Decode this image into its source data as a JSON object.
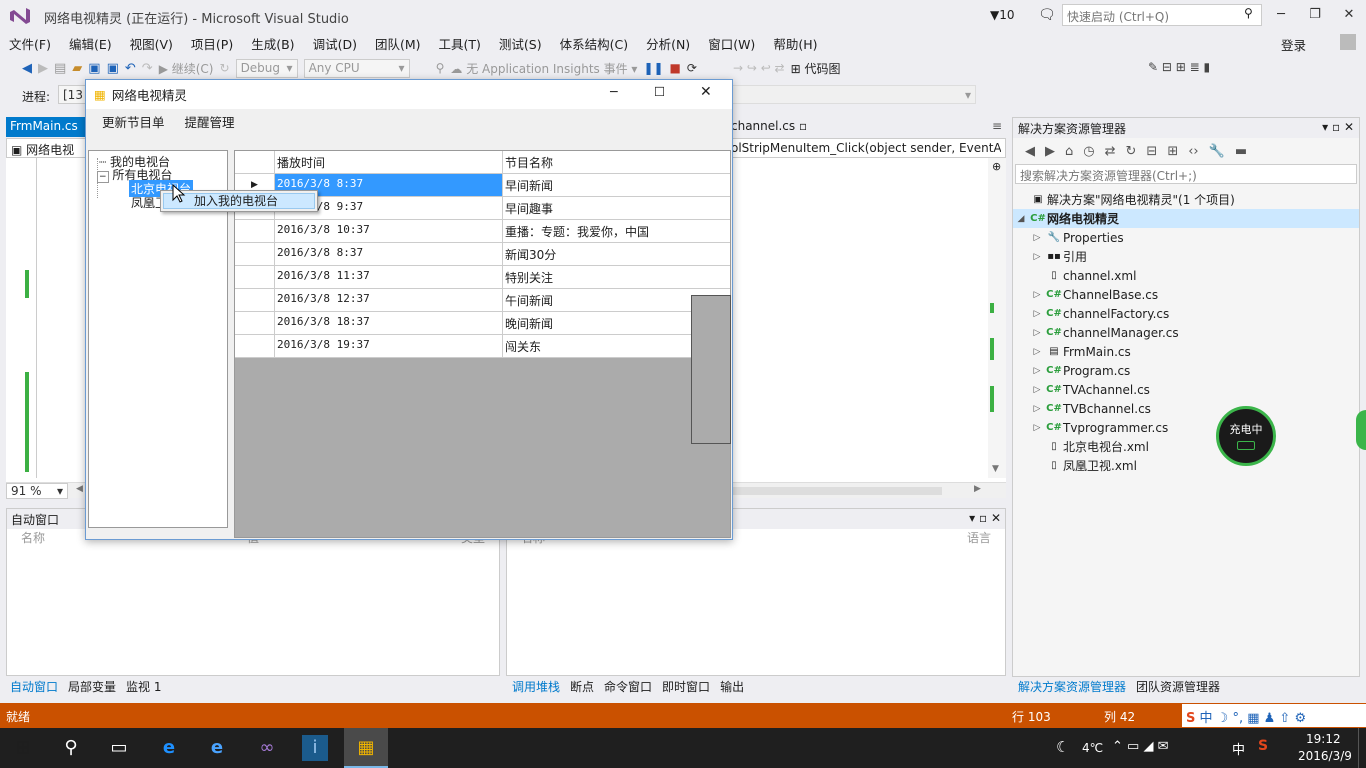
{
  "vs": {
    "title": "网络电视精灵 (正在运行) - Microsoft Visual Studio",
    "notif_count": "10",
    "quick_launch_placeholder": "快速启动 (Ctrl+Q)",
    "login": "登录",
    "menu": [
      "文件(F)",
      "编辑(E)",
      "视图(V)",
      "项目(P)",
      "生成(B)",
      "调试(D)",
      "团队(M)",
      "工具(T)",
      "测试(S)",
      "体系结构(C)",
      "分析(N)",
      "窗口(W)",
      "帮助(H)"
    ],
    "toolbar": {
      "continue": "继续(C)",
      "config": "Debug",
      "platform": "Any CPU",
      "insights": "无 Application Insights 事件",
      "codemap": "代码图"
    },
    "process_label": "进程:",
    "process_value": "[13",
    "doc_tab": "FrmMain.cs",
    "doc_tab2": "channel.cs",
    "nav_left": "网络电视",
    "nav_method": "olStripMenuItem_Click(object sender, EventA",
    "zoom": "91 %"
  },
  "autos": {
    "title": "自动窗口",
    "cols": [
      "名称",
      "值",
      "类型"
    ]
  },
  "callstack": {
    "cols": [
      "名称",
      "语言"
    ]
  },
  "bottom_tabs_left": [
    "自动窗口",
    "局部变量",
    "监视 1"
  ],
  "bottom_tabs_right": [
    "调用堆栈",
    "断点",
    "命令窗口",
    "即时窗口",
    "输出"
  ],
  "solution_explorer": {
    "title": "解决方案资源管理器",
    "search_placeholder": "搜索解决方案资源管理器(Ctrl+;)",
    "solution": "解决方案\"网络电视精灵\"(1 个项目)",
    "project": "网络电视精灵",
    "items": [
      "Properties",
      "引用",
      "channel.xml",
      "ChannelBase.cs",
      "channelFactory.cs",
      "channelManager.cs",
      "FrmMain.cs",
      "Program.cs",
      "TVAchannel.cs",
      "TVBchannel.cs",
      "Tvprogrammer.cs",
      "北京电视台.xml",
      "凤凰卫视.xml"
    ],
    "tabs": [
      "解决方案资源管理器",
      "团队资源管理器"
    ]
  },
  "charging": "充电中",
  "status": {
    "ready": "就绪",
    "line": "行 103",
    "col": "列 42"
  },
  "taskbar": {
    "weather": "4℃",
    "ime": "中",
    "time": "19:12",
    "date": "2016/3/9"
  },
  "app": {
    "title": "网络电视精灵",
    "menu": [
      "更新节目单",
      "提醒管理"
    ],
    "tree": {
      "my": "我的电视台",
      "all": "所有电视台",
      "child1": "北京电视台",
      "child2": "凤凰卫视"
    },
    "context_item": "加入我的电视台",
    "grid_headers": [
      "播放时间",
      "节目名称"
    ],
    "rows": [
      [
        "2016/3/8 8:37",
        "早间新闻"
      ],
      [
        "2016/3/8 9:37",
        "早间趣事"
      ],
      [
        "2016/3/8 10:37",
        "重播：专题：我爱你，中国"
      ],
      [
        "2016/3/8 8:37",
        "新闻30分"
      ],
      [
        "2016/3/8 11:37",
        "特别关注"
      ],
      [
        "2016/3/8 12:37",
        "午间新闻"
      ],
      [
        "2016/3/8 18:37",
        "晚间新闻"
      ],
      [
        "2016/3/8 19:37",
        "闯关东"
      ]
    ]
  }
}
